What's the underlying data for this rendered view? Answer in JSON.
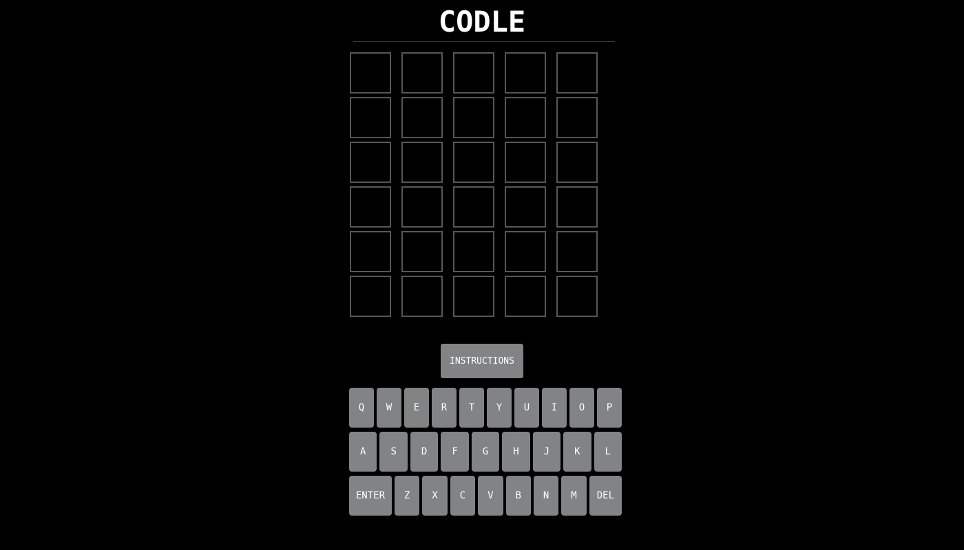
{
  "header": {
    "title": "CODLE"
  },
  "board": {
    "rows": 6,
    "cols": 5,
    "tiles": [
      [
        "",
        "",
        "",
        "",
        ""
      ],
      [
        "",
        "",
        "",
        "",
        ""
      ],
      [
        "",
        "",
        "",
        "",
        ""
      ],
      [
        "",
        "",
        "",
        "",
        ""
      ],
      [
        "",
        "",
        "",
        "",
        ""
      ],
      [
        "",
        "",
        "",
        "",
        ""
      ]
    ]
  },
  "instructions_label": "INSTRUCTIONS",
  "keyboard": {
    "row1": [
      "Q",
      "W",
      "E",
      "R",
      "T",
      "Y",
      "U",
      "I",
      "O",
      "P"
    ],
    "row2": [
      "A",
      "S",
      "D",
      "F",
      "G",
      "H",
      "J",
      "K",
      "L"
    ],
    "row3": [
      "ENTER",
      "Z",
      "X",
      "C",
      "V",
      "B",
      "N",
      "M",
      "DEL"
    ]
  },
  "colors": {
    "background": "#000000",
    "tile_border": "#565758",
    "key_bg": "#818384",
    "text": "#ffffff"
  }
}
